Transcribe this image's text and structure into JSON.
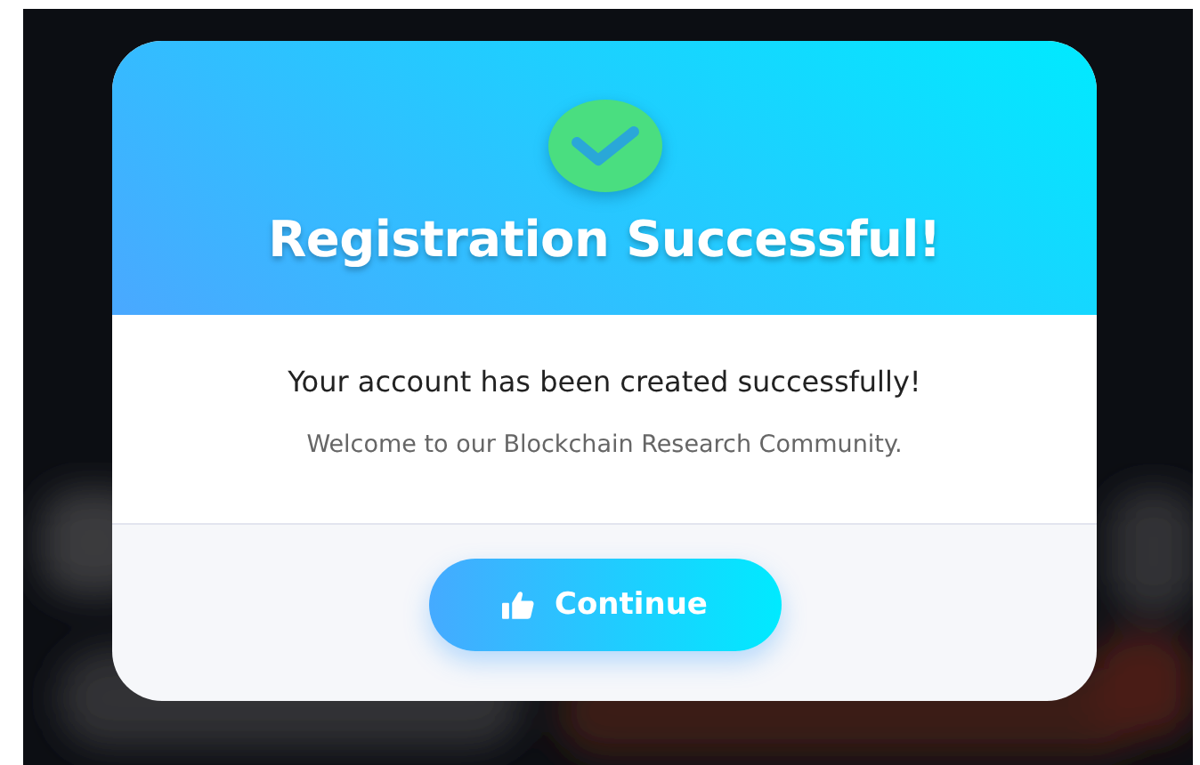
{
  "modal": {
    "title": "Registration Successful!",
    "message": "Your account has been created successfully!",
    "subtitle": "Welcome to our Blockchain Research Community.",
    "button": {
      "label": "Continue"
    }
  }
}
